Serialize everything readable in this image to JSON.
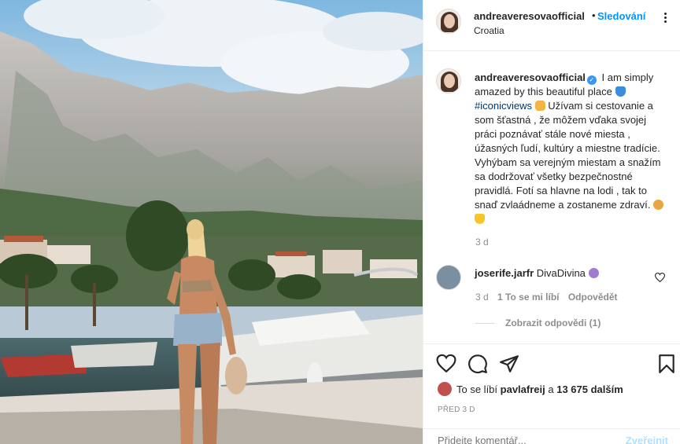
{
  "header": {
    "username": "andreaveresovaofficial",
    "separator": "•",
    "follow_label": "Sledování",
    "location": "Croatia"
  },
  "caption": {
    "username": "andreaveresovaofficial",
    "text_1": "I am simply amazed by this beautiful place",
    "hashtag": "#iconicviews",
    "text_2": "Užívam si cestovanie a som šťastná , že môžem vďaka svojej práci poznávať stále nové miesta , úžasných ľudí, kultúry a miestne tradície. Vyhýbam sa verejným miestam a snažím sa dodržovať všetky bezpečnostné pravidlá. Fotí sa hlavne na lodi , tak to snaď zvlaádneme a zostaneme zdraví.",
    "time": "3 d"
  },
  "comment": {
    "username": "joserife.jarfr",
    "text": "DivaDivina",
    "time": "3 d",
    "likes": "1 To se mi líbí",
    "reply": "Odpovědět",
    "view_replies": "Zobrazit odpovědi (1)"
  },
  "actions": {
    "liked_by_prefix": "To se líbí",
    "liked_by_user": "pavlafreij",
    "liked_by_and": "a",
    "liked_by_count": "13 675 dalším",
    "date": "PŘED 3 D"
  },
  "add_comment": {
    "placeholder": "Přidejte komentář...",
    "publish_label": "Zveřejnit"
  },
  "icons": {
    "heart": "heart-icon",
    "comment": "comment-icon",
    "share": "share-icon",
    "save": "bookmark-icon",
    "more": "more-icon"
  },
  "colors": {
    "accent": "#0095f6",
    "hashtag": "#00376b",
    "muted": "#8e8e8e",
    "text": "#262626"
  }
}
